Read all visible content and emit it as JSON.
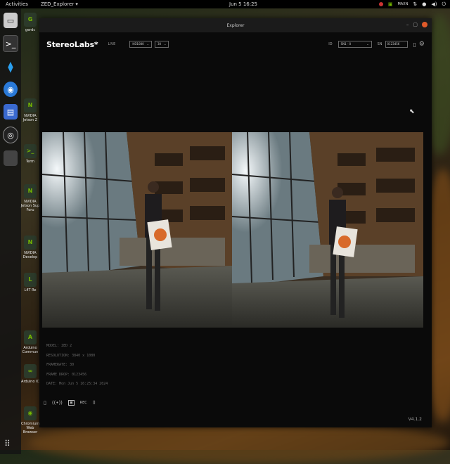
{
  "desktop": {
    "topbar": {
      "activities": "Activities",
      "app_menu": "ZED_Explorer ▾",
      "clock": "Jun 5  16:25",
      "power_mode": "MAXN"
    },
    "dock_icons": [
      "files-icon",
      "terminal-icon",
      "vscode-icon",
      "chromium-icon",
      "text-editor-icon",
      "obs-icon",
      "app-blank-icon"
    ],
    "desktop_icons": [
      {
        "label": "gerdc",
        "icon": "G"
      },
      {
        "label": "NVIDIA Jetson Z",
        "icon": "N"
      },
      {
        "label": "Term",
        "icon": ">_"
      },
      {
        "label": "NVIDIA Jetson Sup Foru",
        "icon": "N"
      },
      {
        "label": "NVIDIA Develop",
        "icon": "N"
      },
      {
        "label": "L4T Re",
        "icon": "L"
      },
      {
        "label": "Arduino Commun",
        "icon": "A"
      },
      {
        "label": "Arduino IC",
        "icon": "∞"
      },
      {
        "label": "Chromium Web Browser",
        "icon": "◉"
      }
    ]
  },
  "window": {
    "title": "Explorer",
    "brand": "StereoLabs*",
    "mode": "LIVE",
    "resolution_select": "HD1080",
    "fps_select": "30",
    "id_label": "ID",
    "serial_select": "SN1 - 0",
    "sn_label": "SN",
    "sn_value": "0123456",
    "info": {
      "model": "MODEL: ZED 2",
      "resolution": "RESOLUTION: 3840 x 1080",
      "framerate": "FRAMERATE: 30",
      "frame_drop": "FRAME DROP: 0123456",
      "date": "DATE: Mon Jun 5 16:25:34 2024"
    },
    "version": "V4.1.2"
  },
  "colors": {
    "accent_green": "#76b900",
    "close_orange": "#e05a2a"
  }
}
